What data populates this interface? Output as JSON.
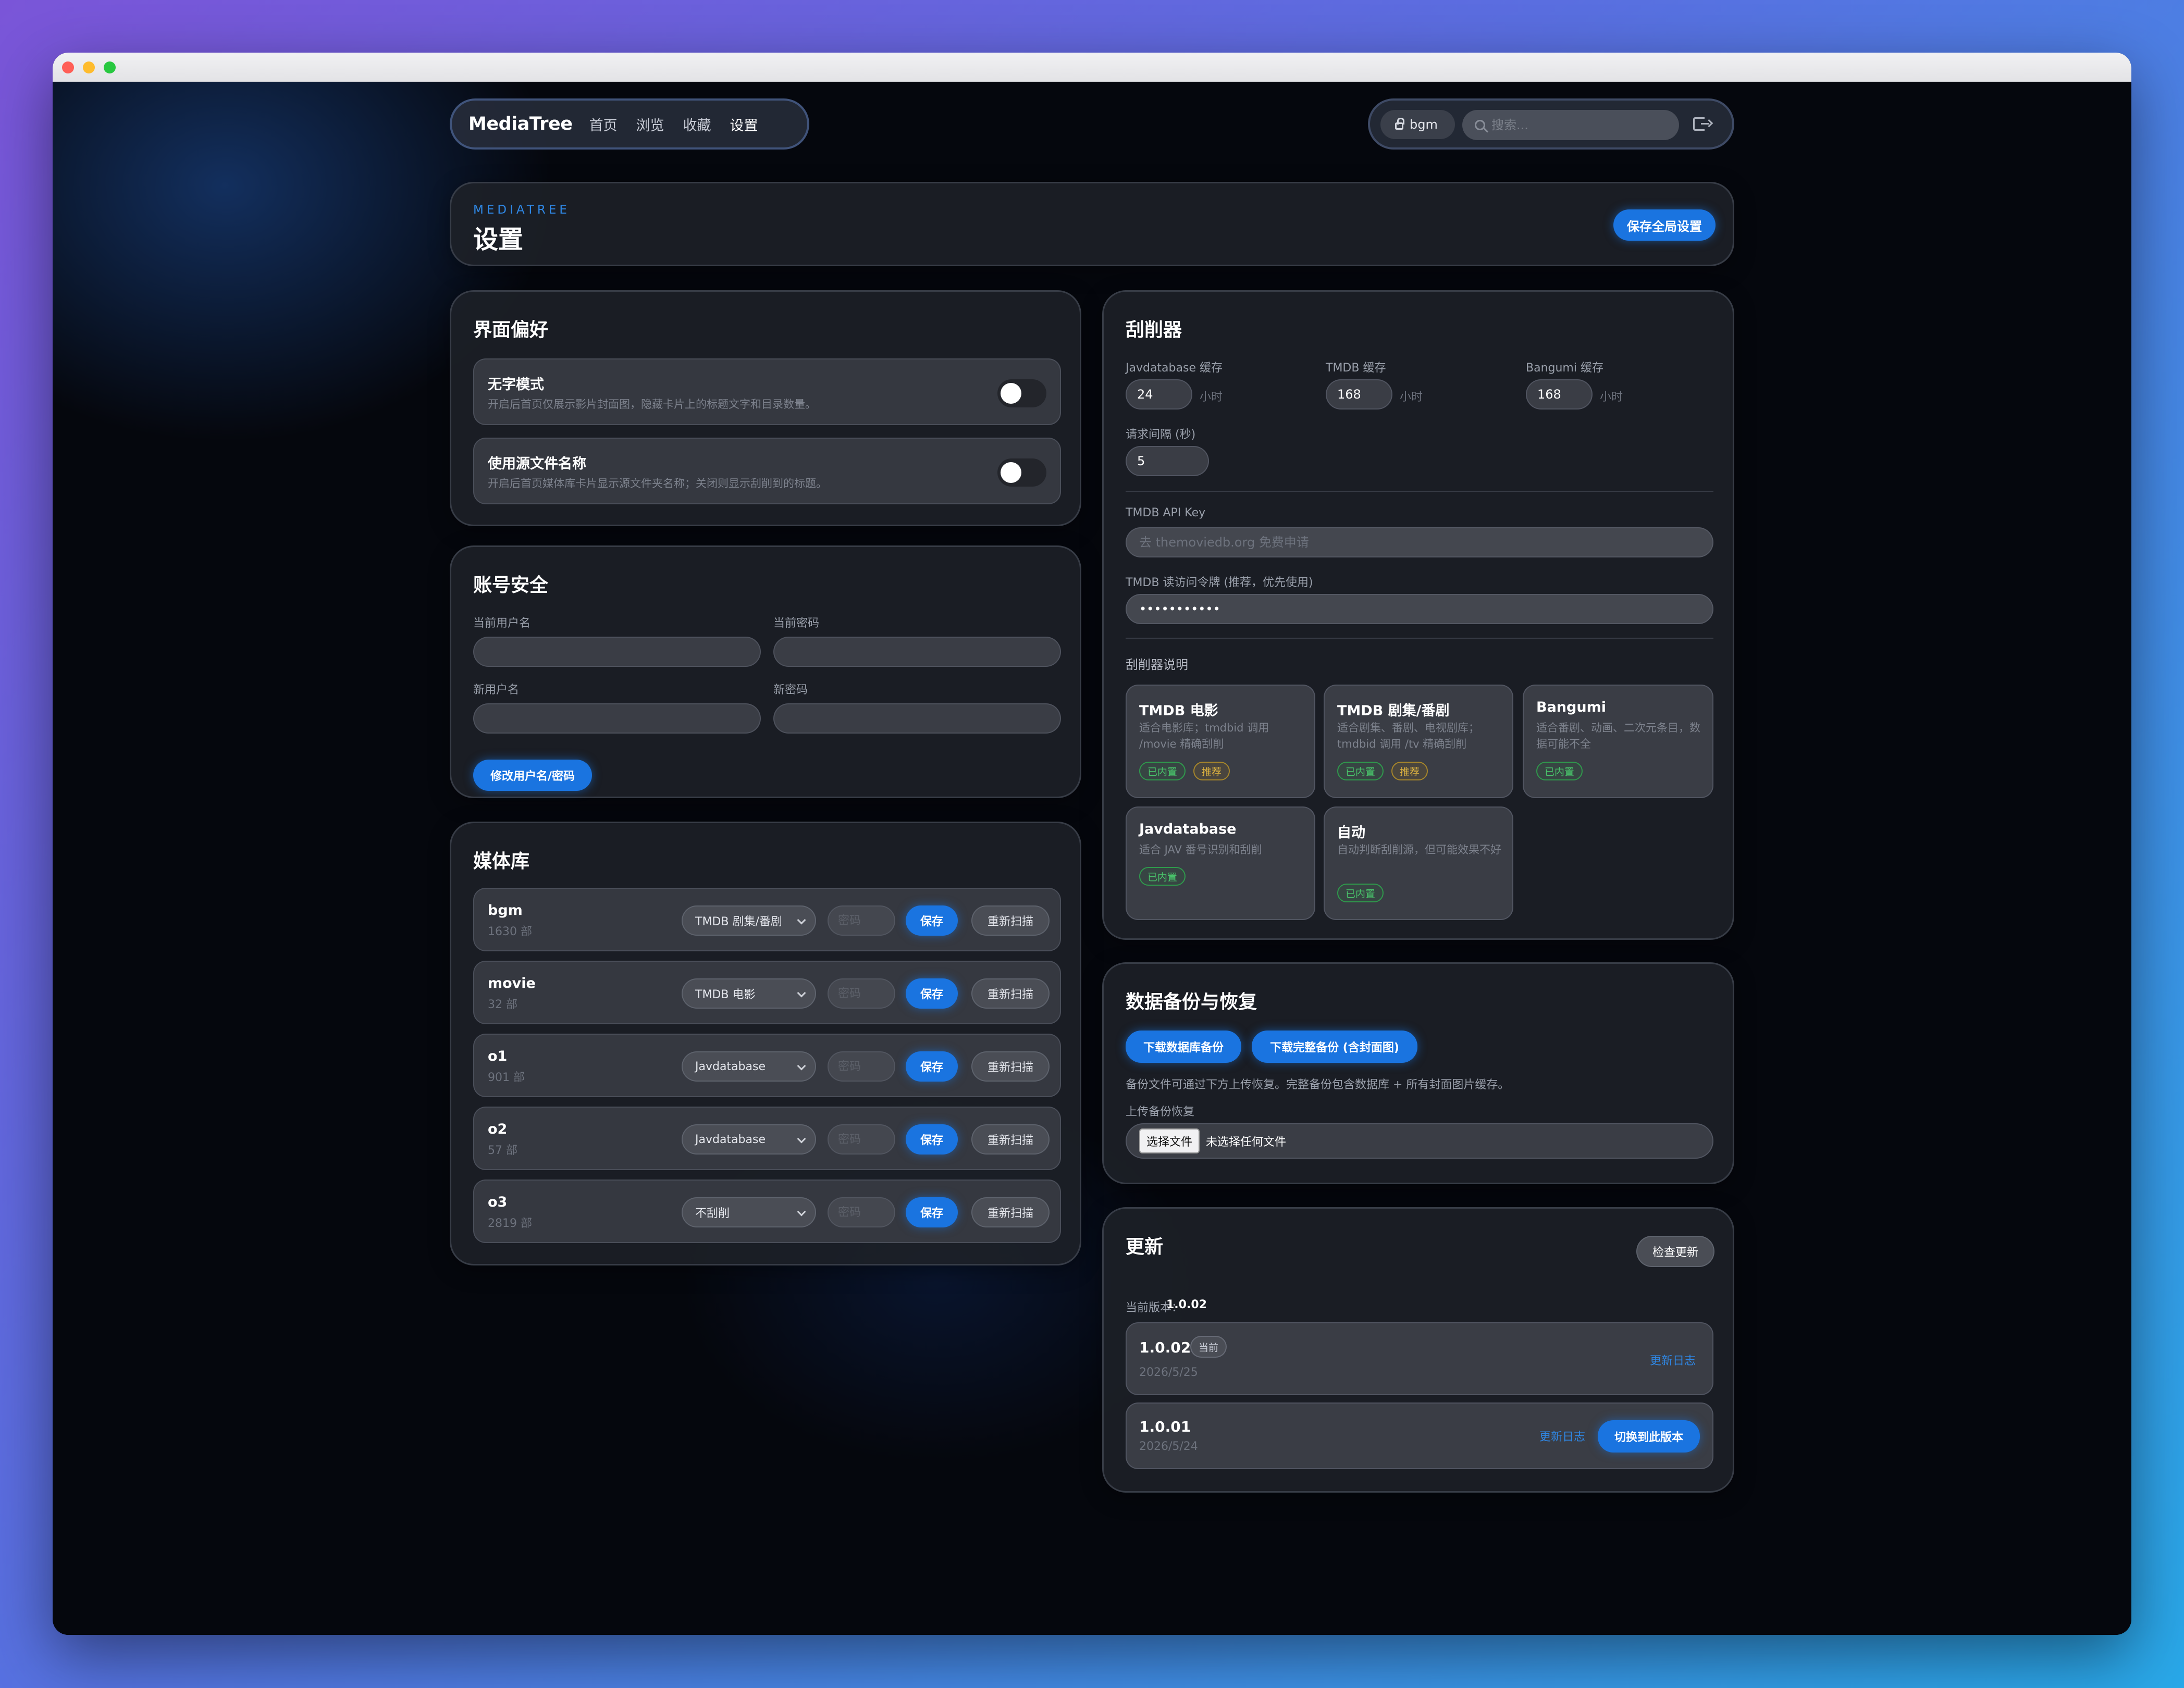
{
  "nav": {
    "brand": "MediaTree",
    "links": [
      "首页",
      "浏览",
      "收藏",
      "设置"
    ],
    "user": "bgm",
    "search_placeholder": "搜索..."
  },
  "header": {
    "eyebrow": "MEDIATREE",
    "title": "设置",
    "save_global": "保存全局设置"
  },
  "ui_prefs": {
    "title": "界面偏好",
    "items": [
      {
        "title": "无字模式",
        "desc": "开启后首页仅展示影片封面图，隐藏卡片上的标题文字和目录数量。",
        "enabled": false
      },
      {
        "title": "使用源文件名称",
        "desc": "开启后首页媒体库卡片显示源文件夹名称；关闭则显示刮削到的标题。",
        "enabled": false
      }
    ]
  },
  "account": {
    "title": "账号安全",
    "current_username": "当前用户名",
    "current_password": "当前密码",
    "new_username": "新用户名",
    "new_password": "新密码",
    "submit": "修改用户名/密码"
  },
  "media": {
    "title": "媒体库",
    "pw_placeholder": "密码",
    "save": "保存",
    "rescan": "重新扫描",
    "rows": [
      {
        "name": "bgm",
        "count": "1630 部",
        "scraper": "TMDB 剧集/番剧"
      },
      {
        "name": "movie",
        "count": "32 部",
        "scraper": "TMDB 电影"
      },
      {
        "name": "o1",
        "count": "901 部",
        "scraper": "Javdatabase"
      },
      {
        "name": "o2",
        "count": "57 部",
        "scraper": "Javdatabase"
      },
      {
        "name": "o3",
        "count": "2819 部",
        "scraper": "不刮削"
      }
    ]
  },
  "scraper": {
    "title": "刮削器",
    "cache": [
      {
        "label": "Javdatabase 缓存",
        "value": "24",
        "unit": "小时"
      },
      {
        "label": "TMDB 缓存",
        "value": "168",
        "unit": "小时"
      },
      {
        "label": "Bangumi 缓存",
        "value": "168",
        "unit": "小时"
      }
    ],
    "interval_label": "请求间隔 (秒)",
    "interval_value": "5",
    "api_key_label": "TMDB API Key",
    "api_key_placeholder": "去 themoviedb.org 免费申请",
    "token_label": "TMDB 读访问令牌 (推荐，优先使用)",
    "token_value": "•••••••••••",
    "info_title": "刮削器说明",
    "cards": [
      {
        "name": "TMDB 电影",
        "desc": "适合电影库；tmdbid 调用 /movie 精确刮削",
        "tags": [
          "已内置",
          "推荐"
        ]
      },
      {
        "name": "TMDB 剧集/番剧",
        "desc": "适合剧集、番剧、电视剧库；tmdbid 调用 /tv 精确刮削",
        "tags": [
          "已内置",
          "推荐"
        ]
      },
      {
        "name": "Bangumi",
        "desc": "适合番剧、动画、二次元条目，数据可能不全",
        "tags": [
          "已内置"
        ]
      },
      {
        "name": "Javdatabase",
        "desc": "适合 JAV 番号识别和刮削",
        "tags": [
          "已内置"
        ]
      },
      {
        "name": "自动",
        "desc": "自动判断刮削源，但可能效果不好",
        "tags": [
          "已内置"
        ]
      }
    ]
  },
  "backup": {
    "title": "数据备份与恢复",
    "download_db": "下载数据库备份",
    "download_full": "下载完整备份 (含封面图)",
    "note": "备份文件可通过下方上传恢复。完整备份包含数据库 + 所有封面图片缓存。",
    "upload_label": "上传备份恢复",
    "choose_file": "选择文件",
    "no_file": "未选择任何文件"
  },
  "update": {
    "title": "更新",
    "check": "检查更新",
    "current_label": "当前版本：",
    "current_value": "1.0.02",
    "current_badge": "当前",
    "changelog": "更新日志",
    "switch": "切换到此版本",
    "versions": [
      {
        "version": "1.0.02",
        "date": "2026/5/25"
      },
      {
        "version": "1.0.01",
        "date": "2026/5/24"
      }
    ]
  },
  "colors": {
    "accent": "#1a74e0",
    "tag_green": "#49c36a",
    "tag_yellow": "#e2b640"
  }
}
